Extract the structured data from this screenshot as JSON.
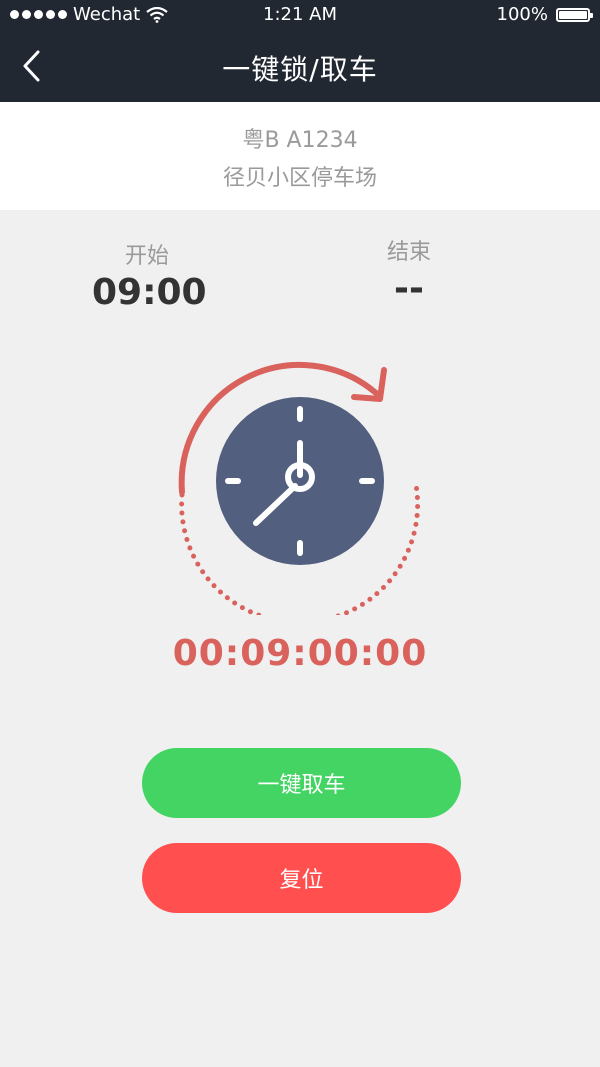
{
  "status_bar": {
    "carrier": "Wechat",
    "time": "1:21 AM",
    "battery": "100%"
  },
  "nav": {
    "title": "一键锁/取车",
    "back_icon": "chevron-left-icon"
  },
  "vehicle": {
    "plate": "粤B A1234",
    "location": "径贝小区停车场"
  },
  "times": {
    "start_label": "开始",
    "start_value": "09:00",
    "end_label": "结束",
    "end_value": "--"
  },
  "counter": "00:09:00:00",
  "actions": {
    "pickup_label": "一键取车",
    "reset_label": "复位"
  },
  "colors": {
    "header_bg": "#222831",
    "accent_red": "#d9625d",
    "clock_face": "#525f7f",
    "green_button": "#44d463",
    "red_button": "#ff4f4f"
  }
}
